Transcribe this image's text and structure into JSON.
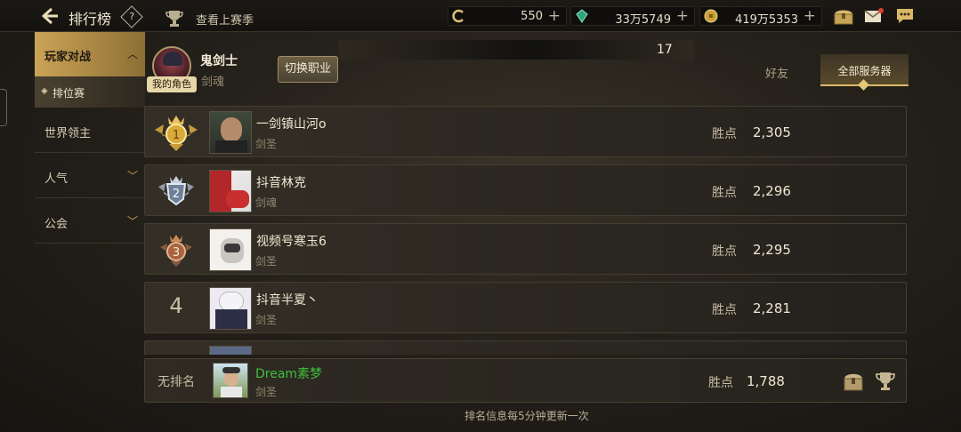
{
  "header": {
    "title": "排行榜",
    "help_glyph": "?",
    "last_season_label": "查看上赛季"
  },
  "currencies": [
    {
      "icon": "coin-c-icon",
      "value": "550",
      "plus": "+"
    },
    {
      "icon": "green-crystal-icon",
      "value": "33万5749",
      "plus": "+"
    },
    {
      "icon": "gold-coin-icon",
      "value": "419万5353",
      "plus": "+"
    }
  ],
  "sidebar": {
    "main_label": "玩家对战",
    "sub_label": "排位赛",
    "items": [
      {
        "label": "世界领主",
        "has_chevron": false
      },
      {
        "label": "人气",
        "has_chevron": true
      },
      {
        "label": "公会",
        "has_chevron": true
      }
    ]
  },
  "profile": {
    "my_character_badge": "我的角色",
    "name": "鬼剑士",
    "class": "剑魂",
    "switch_job_label": "切换职业",
    "progress_value": "17"
  },
  "tabs": {
    "friends": "好友",
    "all_servers": "全部服务器",
    "active": "all_servers"
  },
  "ranking": {
    "points_label": "胜点",
    "rows": [
      {
        "rank": "1",
        "name": "一剑镇山河o",
        "class": "剑圣",
        "points": "2,305",
        "badge": "gold"
      },
      {
        "rank": "2",
        "name": "抖音林克",
        "class": "剑魂",
        "points": "2,296",
        "badge": "silver"
      },
      {
        "rank": "3",
        "name": "视频号寒玉6",
        "class": "剑圣",
        "points": "2,295",
        "badge": "bronze"
      },
      {
        "rank": "4",
        "name": "抖音半夏丶",
        "class": "剑圣",
        "points": "2,281",
        "badge": "none"
      }
    ]
  },
  "self": {
    "rank_text": "无排名",
    "name": "Dream素梦",
    "class": "剑圣",
    "points_label": "胜点",
    "points": "1,788"
  },
  "footer": {
    "note": "排名信息每5分钟更新一次"
  },
  "colors": {
    "accent_gold": "#caa356",
    "self_name_green": "#3fbf3f",
    "background": "#25211b"
  }
}
